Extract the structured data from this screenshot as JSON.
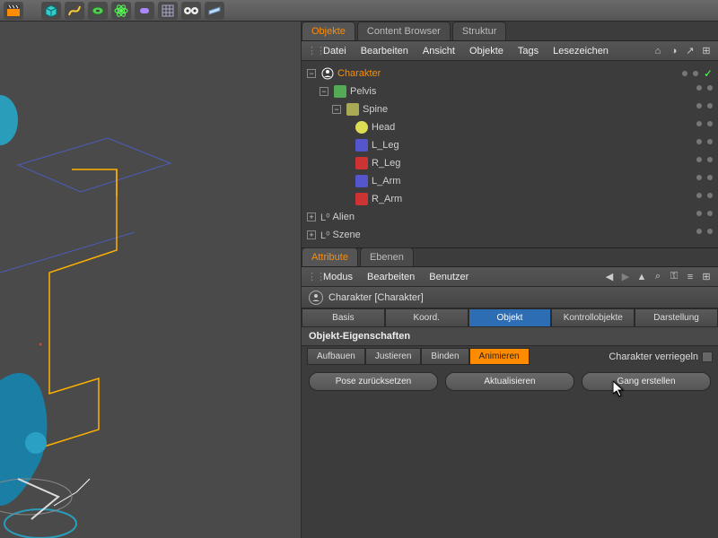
{
  "toolbar_icons": [
    "clapper",
    "cube",
    "curve",
    "torus",
    "atom",
    "capsule",
    "grid",
    "eyes",
    "plane"
  ],
  "panel_tabs": {
    "objects": "Objekte",
    "content_browser": "Content Browser",
    "structure": "Struktur"
  },
  "menu": {
    "file": "Datei",
    "edit": "Bearbeiten",
    "view": "Ansicht",
    "objects": "Objekte",
    "tags": "Tags",
    "bookmarks": "Lesezeichen"
  },
  "tree": {
    "character": "Charakter",
    "pelvis": "Pelvis",
    "spine": "Spine",
    "head": "Head",
    "l_leg": "L_Leg",
    "r_leg": "R_Leg",
    "l_arm": "L_Arm",
    "r_arm": "R_Arm",
    "alien": "Alien",
    "scene": "Szene",
    "null_prefix": "L⁰"
  },
  "attr_tabs": {
    "attributes": "Attribute",
    "layers": "Ebenen"
  },
  "attr_menu": {
    "mode": "Modus",
    "edit": "Bearbeiten",
    "user": "Benutzer"
  },
  "obj_header": "Charakter [Charakter]",
  "tabs": {
    "basis": "Basis",
    "koord": "Koord.",
    "objekt": "Objekt",
    "kontroll": "Kontrollobjekte",
    "darstellung": "Darstellung"
  },
  "section": "Objekt-Eigenschaften",
  "subtabs": {
    "aufbauen": "Aufbauen",
    "justieren": "Justieren",
    "binden": "Binden",
    "animieren": "Animieren"
  },
  "lock_label": "Charakter verriegeln",
  "buttons": {
    "reset_pose": "Pose zurücksetzen",
    "update": "Aktualisieren",
    "create_walk": "Gang erstellen"
  }
}
